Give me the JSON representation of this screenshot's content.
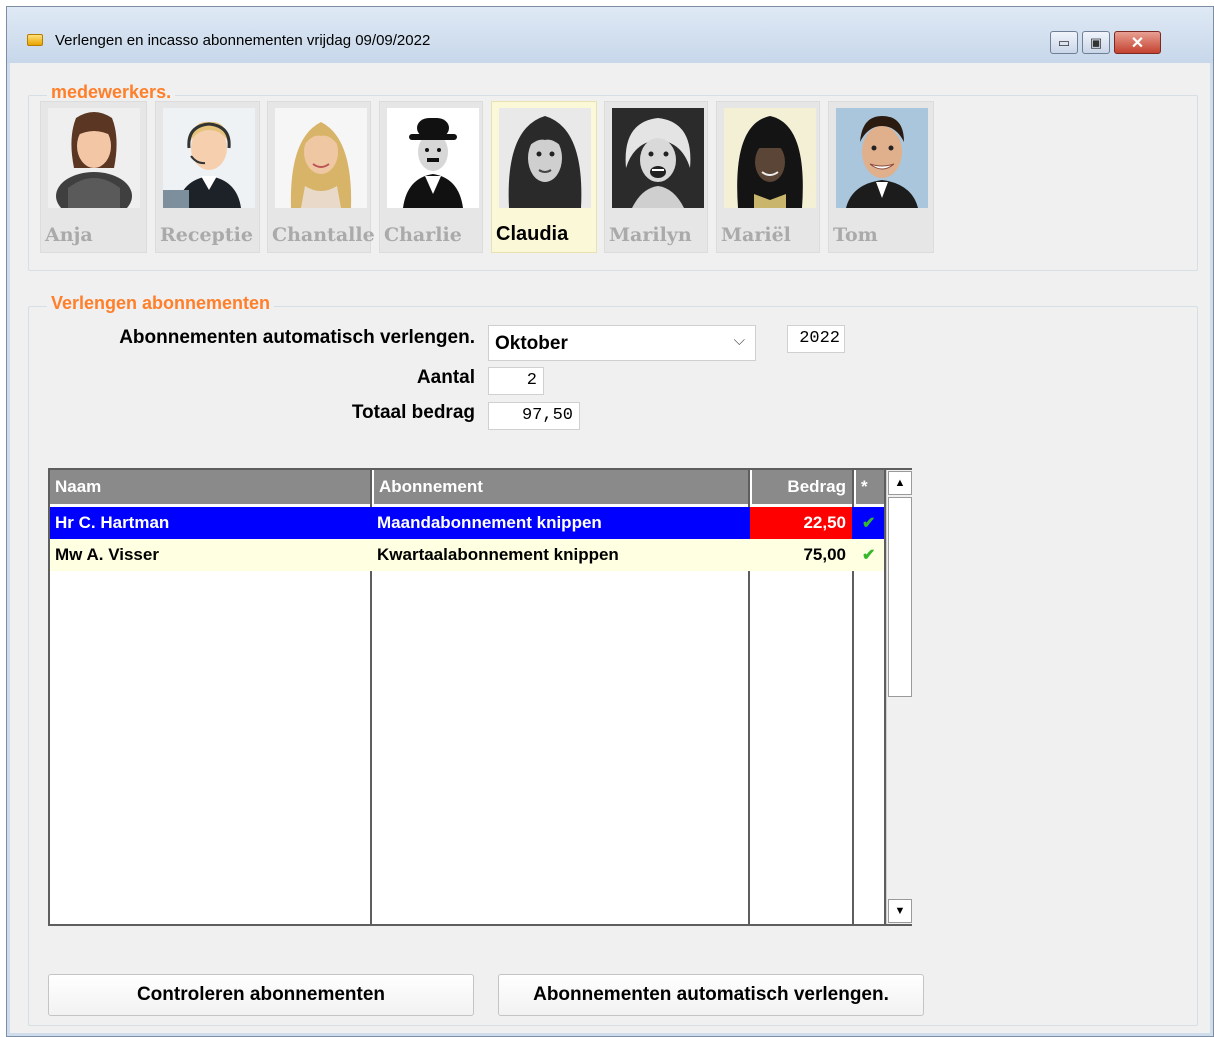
{
  "window": {
    "title": "Verlengen en incasso abonnementen vrijdag 09/09/2022",
    "min_symbol": "▭",
    "max_symbol": "▣",
    "close_symbol": "✕"
  },
  "staff_group": {
    "legend": "medewerkers.",
    "members": [
      {
        "name": "Anja",
        "active": false
      },
      {
        "name": "Receptie",
        "active": false
      },
      {
        "name": "Chantalle",
        "active": false
      },
      {
        "name": "Charlie",
        "active": false
      },
      {
        "name": "Claudia",
        "active": true
      },
      {
        "name": "Marilyn",
        "active": false
      },
      {
        "name": "Mariël",
        "active": false
      },
      {
        "name": "Tom",
        "active": false
      }
    ]
  },
  "renew_group": {
    "legend": "Verlengen abonnementen",
    "auto_label": "Abonnementen automatisch verlengen.",
    "month_value": "Oktober",
    "month_chevron": "⌵",
    "year_value": "2022",
    "count_label": "Aantal",
    "count_value": "2",
    "total_label": "Totaal bedrag",
    "total_value": "97,50"
  },
  "table": {
    "headers": {
      "name": "Naam",
      "subscription": "Abonnement",
      "amount": "Bedrag",
      "flag": "*"
    },
    "rows": [
      {
        "name": "Hr C. Hartman",
        "subscription": "Maandabonnement knippen",
        "amount": "22,50",
        "check": "✔",
        "selected": true
      },
      {
        "name": "Mw A. Visser",
        "subscription": "Kwartaalabonnement knippen",
        "amount": "75,00",
        "check": "✔",
        "selected": false
      }
    ],
    "scroll_up": "▲",
    "scroll_down": "▼"
  },
  "buttons": {
    "check_label": "Controleren abonnementen",
    "auto_renew_label": "Abonnementen automatisch verlengen."
  },
  "colors": {
    "accent_orange": "#ff7f2a",
    "selected_row": "#0000ff",
    "selected_amount": "#ff0000",
    "row_alt": "#ffffe1",
    "header_grey": "#8a8a8a"
  }
}
